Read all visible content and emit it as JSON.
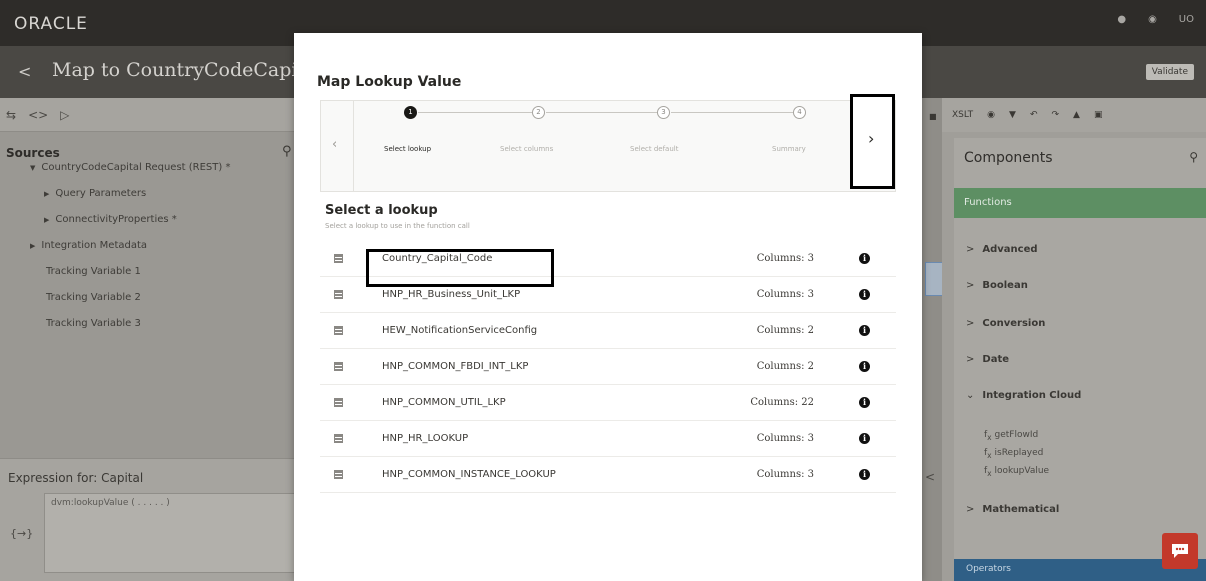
{
  "brand": "ORACLE",
  "top_icons": [
    "notification-icon",
    "help-icon",
    "user-initials"
  ],
  "user_initials": "UO",
  "page_title": "Map to CountryCodeCapital",
  "validate_label": "Validate",
  "left_panel": {
    "sources_title": "Sources",
    "tree": [
      {
        "label": "CountryCodeCapital Request (REST) *",
        "level": 1,
        "expanded": true
      },
      {
        "label": "Query Parameters",
        "level": 2
      },
      {
        "label": "ConnectivityProperties *",
        "level": 2
      },
      {
        "label": "Integration Metadata",
        "level": 1
      },
      {
        "label": "Tracking Variable 1",
        "level": 1
      },
      {
        "label": "Tracking Variable 2",
        "level": 1
      },
      {
        "label": "Tracking Variable 3",
        "level": 1
      }
    ],
    "expression_title": "Expression for: Capital",
    "expression_text": "dvm:lookupValue ( . . . . . )",
    "expression_icon": "{→}"
  },
  "right_panel": {
    "toolbar_xslt": "XSLT",
    "components_title": "Components",
    "functions_label": "Functions",
    "categories": [
      "Advanced",
      "Boolean",
      "Conversion",
      "Date",
      "Integration Cloud",
      "Mathematical"
    ],
    "integration_cloud_functions": [
      "getFlowId",
      "isReplayed",
      "lookupValue"
    ],
    "operators_label": "Operators"
  },
  "modal": {
    "title": "Map Lookup Value",
    "steps": [
      {
        "num": "1",
        "label": "Select lookup",
        "active": true
      },
      {
        "num": "2",
        "label": "Select columns",
        "active": false
      },
      {
        "num": "3",
        "label": "Select default",
        "active": false
      },
      {
        "num": "4",
        "label": "Summary",
        "active": false
      }
    ],
    "prev_icon": "‹",
    "next_icon": "›",
    "select_title": "Select a lookup",
    "select_subtitle": "Select a lookup to use in the function call",
    "lookups": [
      {
        "name": "Country_Capital_Code",
        "columns": "Columns: 3"
      },
      {
        "name": "HNP_HR_Business_Unit_LKP",
        "columns": "Columns: 3"
      },
      {
        "name": "HEW_NotificationServiceConfig",
        "columns": "Columns: 2"
      },
      {
        "name": "HNP_COMMON_FBDI_INT_LKP",
        "columns": "Columns: 2"
      },
      {
        "name": "HNP_COMMON_UTIL_LKP",
        "columns": "Columns: 22"
      },
      {
        "name": "HNP_HR_LOOKUP",
        "columns": "Columns: 3"
      },
      {
        "name": "HNP_COMMON_INSTANCE_LOOKUP",
        "columns": "Columns: 3"
      }
    ],
    "info_glyph": "i"
  },
  "colors": {
    "functions_band": "#5d8f63",
    "operators_band": "#2f5f86",
    "chat_button": "#c3392b"
  }
}
